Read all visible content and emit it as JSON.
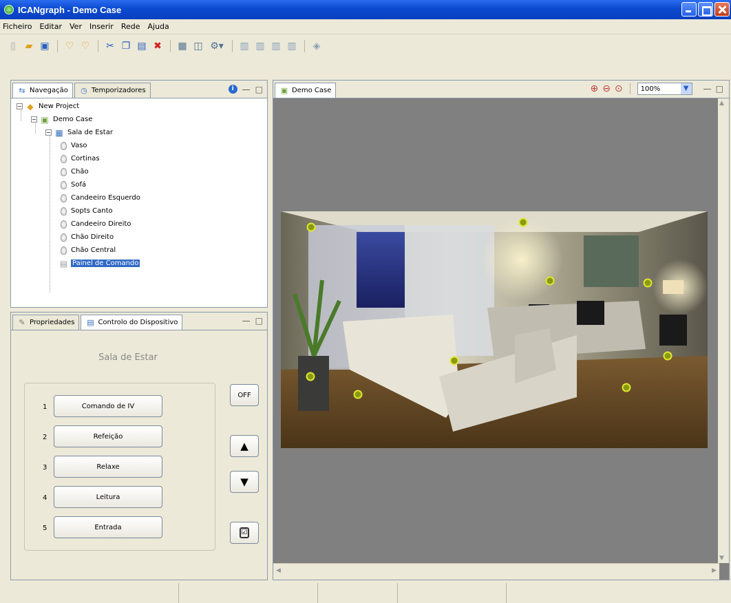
{
  "window": {
    "title": "ICANgraph - Demo Case"
  },
  "menu": [
    "Ficheiro",
    "Editar",
    "Ver",
    "Inserir",
    "Rede",
    "Ajuda"
  ],
  "toolbar_icons": [
    "new-file-icon",
    "open-folder-icon",
    "save-icon",
    "heart-icon",
    "heart-outline-icon",
    "cut-icon",
    "copy-icon",
    "paste-icon",
    "delete-icon",
    "grid-icon",
    "layout-icon",
    "gear-dropdown-icon",
    "align-left-icon",
    "align-center-icon",
    "align-right-icon",
    "align-top-icon",
    "rotate-icon"
  ],
  "nav_panel": {
    "tabs": [
      "Navegação",
      "Temporizadores"
    ],
    "tree": {
      "project": "New Project",
      "case": "Demo Case",
      "room": "Sala de Estar",
      "devices": [
        "Vaso",
        "Cortinas",
        "Chão",
        "Sofá",
        "Candeeiro Esquerdo",
        "Sopts Canto",
        "Candeeiro Direito",
        "Chão Direito",
        "Chão Central"
      ],
      "selected": "Painel de Comando"
    }
  },
  "device_panel": {
    "tabs": [
      "Propriedades",
      "Controlo do Dispositivo"
    ],
    "room_title": "Sala de Estar",
    "scenes": [
      {
        "num": "1",
        "label": "Comando de IV"
      },
      {
        "num": "2",
        "label": "Refeição"
      },
      {
        "num": "3",
        "label": "Relaxe"
      },
      {
        "num": "4",
        "label": "Leitura"
      },
      {
        "num": "5",
        "label": "Entrada"
      }
    ],
    "off_label": "OFF",
    "up_symbol": "▲",
    "down_symbol": "▼"
  },
  "editor": {
    "tab": "Demo Case",
    "zoom": "100%"
  },
  "hotspot_count": 10
}
